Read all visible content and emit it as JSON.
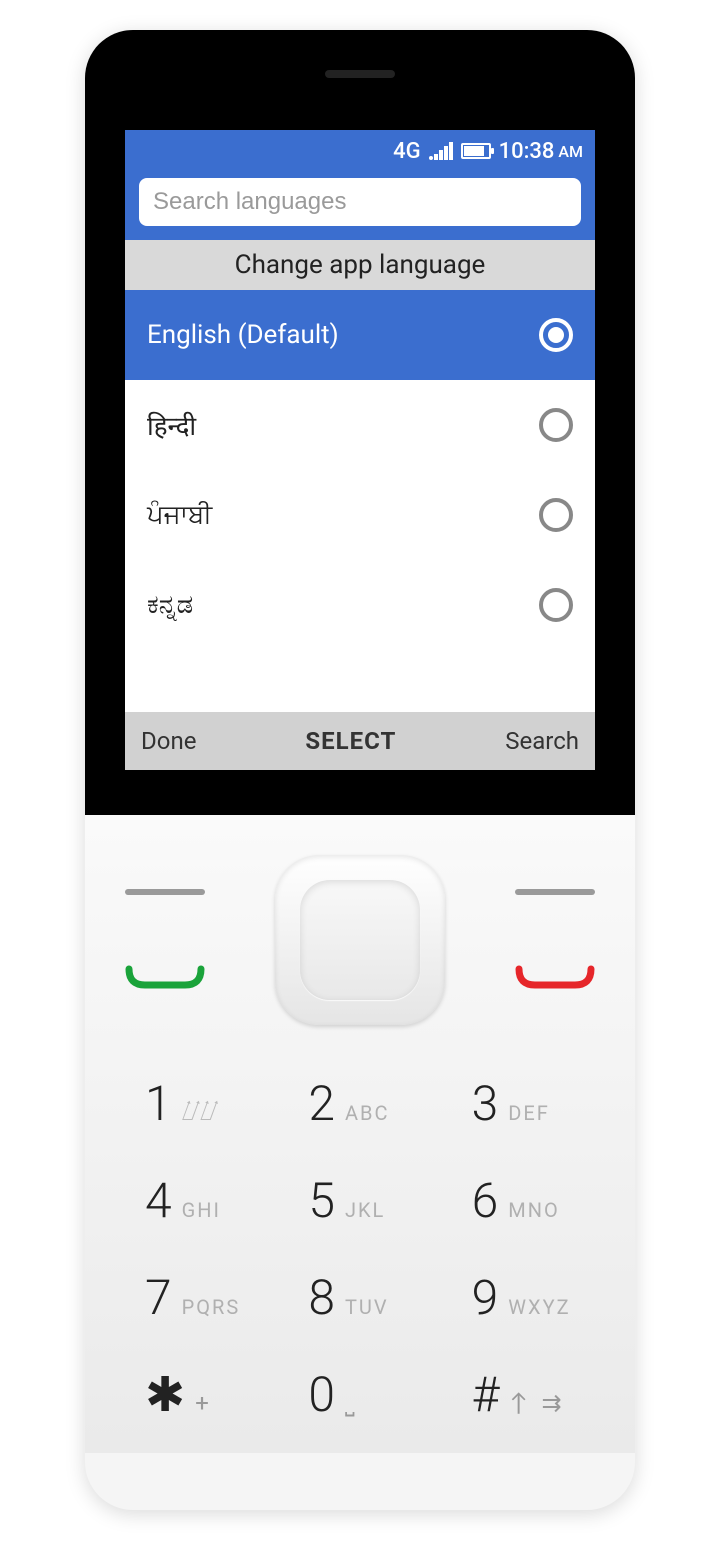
{
  "status": {
    "network_label": "4G",
    "time": "10:38",
    "ampm": "AM"
  },
  "search": {
    "placeholder": "Search languages",
    "value": ""
  },
  "section_title": "Change app language",
  "languages": [
    {
      "label": "English (Default)",
      "selected": true
    },
    {
      "label": "हिन्दी",
      "selected": false
    },
    {
      "label": "ਪੰਜਾਬੀ",
      "selected": false
    },
    {
      "label": "ಕನ್ನಡ",
      "selected": false
    }
  ],
  "softkeys": {
    "left": "Done",
    "center": "SELECT",
    "right": "Search"
  },
  "keypad": [
    {
      "num": "1",
      "sub": "⌰⌰",
      "cls": "vm"
    },
    {
      "num": "2",
      "sub": "ABC"
    },
    {
      "num": "3",
      "sub": "DEF"
    },
    {
      "num": "4",
      "sub": "GHI"
    },
    {
      "num": "5",
      "sub": "JKL"
    },
    {
      "num": "6",
      "sub": "MNO"
    },
    {
      "num": "7",
      "sub": "PQRS"
    },
    {
      "num": "8",
      "sub": "TUV"
    },
    {
      "num": "9",
      "sub": "WXYZ"
    },
    {
      "num": "✱",
      "sub": "+",
      "cls": "sym"
    },
    {
      "num": "0",
      "sub": "⎵",
      "cls": "sym"
    },
    {
      "num": "#",
      "sub": "↑ ⇉",
      "cls": "sym"
    }
  ]
}
